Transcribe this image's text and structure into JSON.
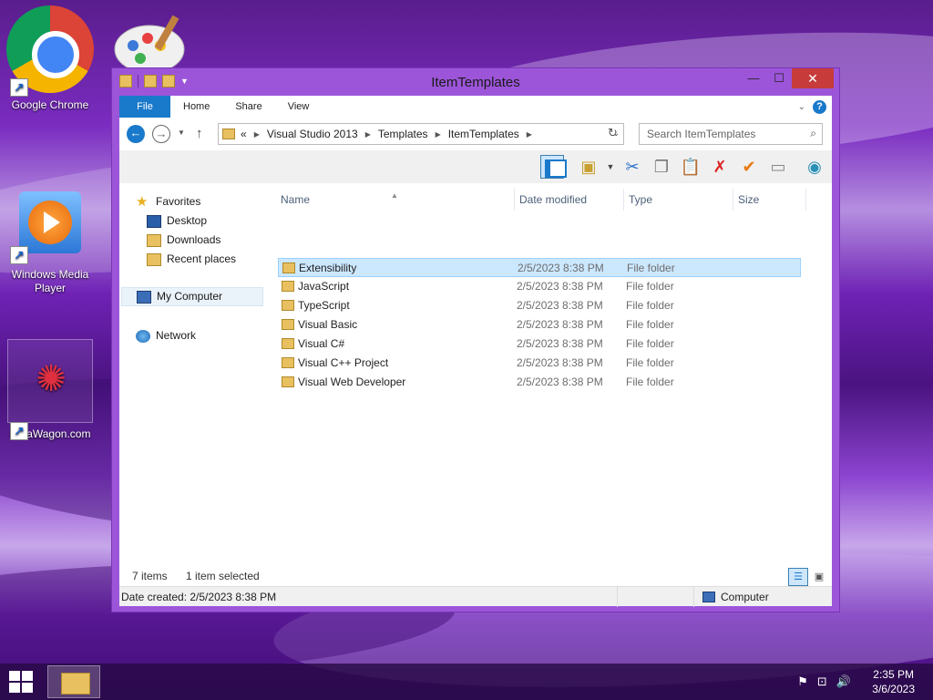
{
  "desktop": {
    "icons": [
      {
        "label": "Google Chrome"
      },
      {
        "label": "Windows Media Player"
      },
      {
        "label": "DataWagon.com"
      }
    ]
  },
  "window": {
    "title": "ItemTemplates",
    "ribbon_tabs": [
      "File",
      "Home",
      "Share",
      "View"
    ],
    "address": {
      "prefix": "«",
      "crumbs": [
        "Visual Studio 2013",
        "Templates",
        "ItemTemplates"
      ]
    },
    "search": {
      "placeholder": "Search ItemTemplates"
    },
    "nav": {
      "favorites": "Favorites",
      "desktop": "Desktop",
      "downloads": "Downloads",
      "recent": "Recent places",
      "computer": "My Computer",
      "network": "Network"
    },
    "columns": {
      "name": "Name",
      "date": "Date modified",
      "type": "Type",
      "size": "Size"
    },
    "files": [
      {
        "name": "Extensibility",
        "date": "2/5/2023 8:38 PM",
        "type": "File folder",
        "selected": true
      },
      {
        "name": "JavaScript",
        "date": "2/5/2023 8:38 PM",
        "type": "File folder"
      },
      {
        "name": "TypeScript",
        "date": "2/5/2023 8:38 PM",
        "type": "File folder"
      },
      {
        "name": "Visual Basic",
        "date": "2/5/2023 8:38 PM",
        "type": "File folder"
      },
      {
        "name": "Visual C#",
        "date": "2/5/2023 8:38 PM",
        "type": "File folder"
      },
      {
        "name": "Visual C++ Project",
        "date": "2/5/2023 8:38 PM",
        "type": "File folder"
      },
      {
        "name": "Visual Web Developer",
        "date": "2/5/2023 8:38 PM",
        "type": "File folder"
      }
    ],
    "status": {
      "count": "7 items",
      "selection": "1 item selected"
    },
    "statusbar": {
      "left": "Date created: 2/5/2023 8:38 PM",
      "right": "Computer"
    }
  },
  "taskbar": {
    "time": "2:35 PM",
    "date": "3/6/2023"
  },
  "icons": [
    "folder-icon",
    "back-icon",
    "forward-icon",
    "up-icon",
    "refresh-icon",
    "search-icon",
    "cut-icon",
    "copy-icon",
    "paste-icon",
    "delete-icon",
    "properties-icon",
    "rename-icon",
    "globe-icon",
    "star-icon",
    "computer-icon",
    "network-icon"
  ]
}
